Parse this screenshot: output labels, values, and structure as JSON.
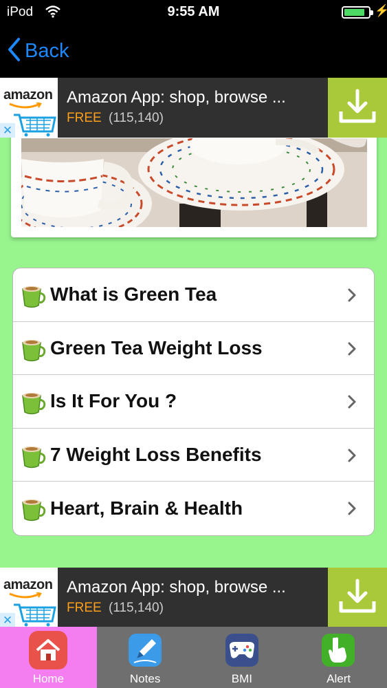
{
  "status_bar": {
    "carrier": "iPod",
    "time": "9:55 AM",
    "battery_level": 0.85
  },
  "nav": {
    "back_label": "Back"
  },
  "ads": {
    "top": {
      "brand": "amazon",
      "title": "Amazon App: shop, browse ...",
      "price": "FREE",
      "rating_count": "(115,140)",
      "close_glyph": "✕"
    },
    "bottom": {
      "brand": "amazon",
      "title": "Amazon App: shop, browse ...",
      "price": "FREE",
      "rating_count": "(115,140)",
      "close_glyph": "✕"
    }
  },
  "menu": {
    "items": [
      {
        "label": "What is Green Tea",
        "icon": "tea-cup-icon"
      },
      {
        "label": "Green Tea Weight Loss",
        "icon": "tea-cup-icon"
      },
      {
        "label": "Is It For You ?",
        "icon": "tea-cup-icon"
      },
      {
        "label": "7 Weight Loss Benefits",
        "icon": "tea-cup-icon"
      },
      {
        "label": "Heart, Brain & Health",
        "icon": "tea-cup-icon"
      }
    ]
  },
  "tabs": [
    {
      "label": "Home",
      "icon": "home-icon",
      "active": true
    },
    {
      "label": "Notes",
      "icon": "pen-icon",
      "active": false
    },
    {
      "label": "BMI",
      "icon": "gamepad-icon",
      "active": false
    },
    {
      "label": "Alert",
      "icon": "hand-pointer-icon",
      "active": false
    }
  ],
  "colors": {
    "background": "#98f58e",
    "ios_blue": "#1e88ff",
    "ad_download": "#a9c93a",
    "ad_price": "#ff9f1c",
    "tab_active": "#f47ef0",
    "tab_bar": "#6f6f6f"
  }
}
